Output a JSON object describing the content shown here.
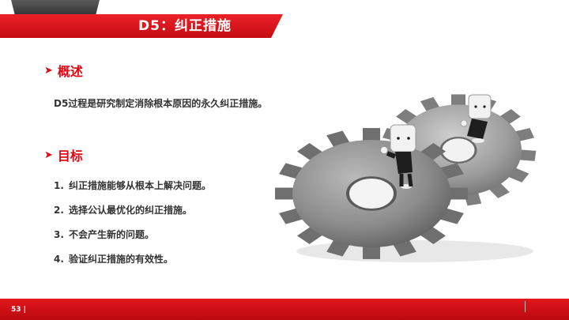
{
  "header": {
    "title": "D5：纠正措施"
  },
  "sections": {
    "overview": {
      "heading": "概述",
      "text": "D5过程是研究制定消除根本原因的永久纠正措施。"
    },
    "goals": {
      "heading": "目标",
      "items": [
        {
          "num": "1.",
          "text": "纠正措施能够从根本上解决问题。"
        },
        {
          "num": "2.",
          "text": "选择公认最优化的纠正措施。"
        },
        {
          "num": "3.",
          "text": "不会产生新的问题。"
        },
        {
          "num": "4.",
          "text": "验证纠正措施的有效性。"
        }
      ]
    }
  },
  "footer": {
    "page": "53 |"
  },
  "colors": {
    "accent": "#e30613",
    "text": "#333333",
    "band_red": "#d7141b",
    "gear_gray": "#8a8a8a"
  },
  "icons": {
    "bullet": "arrowhead-bullet-icon"
  },
  "illustration": "two-gears-with-figures"
}
